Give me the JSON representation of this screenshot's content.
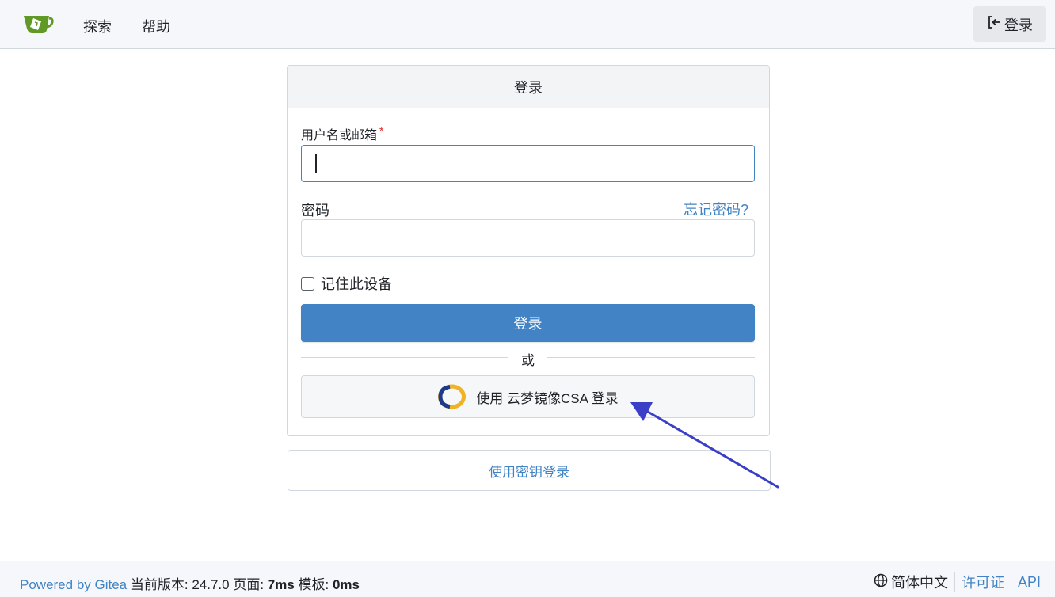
{
  "navbar": {
    "explore_label": "探索",
    "help_label": "帮助",
    "signin_label": "登录",
    "logo_icon": "gitea-tea-cup-icon",
    "signin_icon": "sign-in-icon"
  },
  "login_card": {
    "title": "登录",
    "username_label": "用户名或邮箱",
    "username_required_mark": "*",
    "username_value": "",
    "password_label": "密码",
    "password_value": "",
    "forgot_password_label": "忘记密码?",
    "remember_label": "记住此设备",
    "remember_checked": false,
    "submit_label": "登录",
    "divider_label": "或",
    "oauth_label": "使用 云梦镜像CSA 登录",
    "oauth_icon": "csa-ring-logo-icon"
  },
  "passkey_card": {
    "label": "使用密钥登录"
  },
  "footer": {
    "powered_by": "Powered by Gitea",
    "version_label": "当前版本: ",
    "version_value": "24.7.0",
    "page_label": " 页面: ",
    "page_value": "7ms",
    "template_label": " 模板: ",
    "template_value": "0ms",
    "language_label": "简体中文",
    "language_icon": "globe-icon",
    "license_label": "许可证",
    "api_label": "API"
  },
  "colors": {
    "accent": "#4183c4",
    "required": "#db2828",
    "logo_green": "#609926",
    "annotation_arrow": "#3b3fc7"
  }
}
